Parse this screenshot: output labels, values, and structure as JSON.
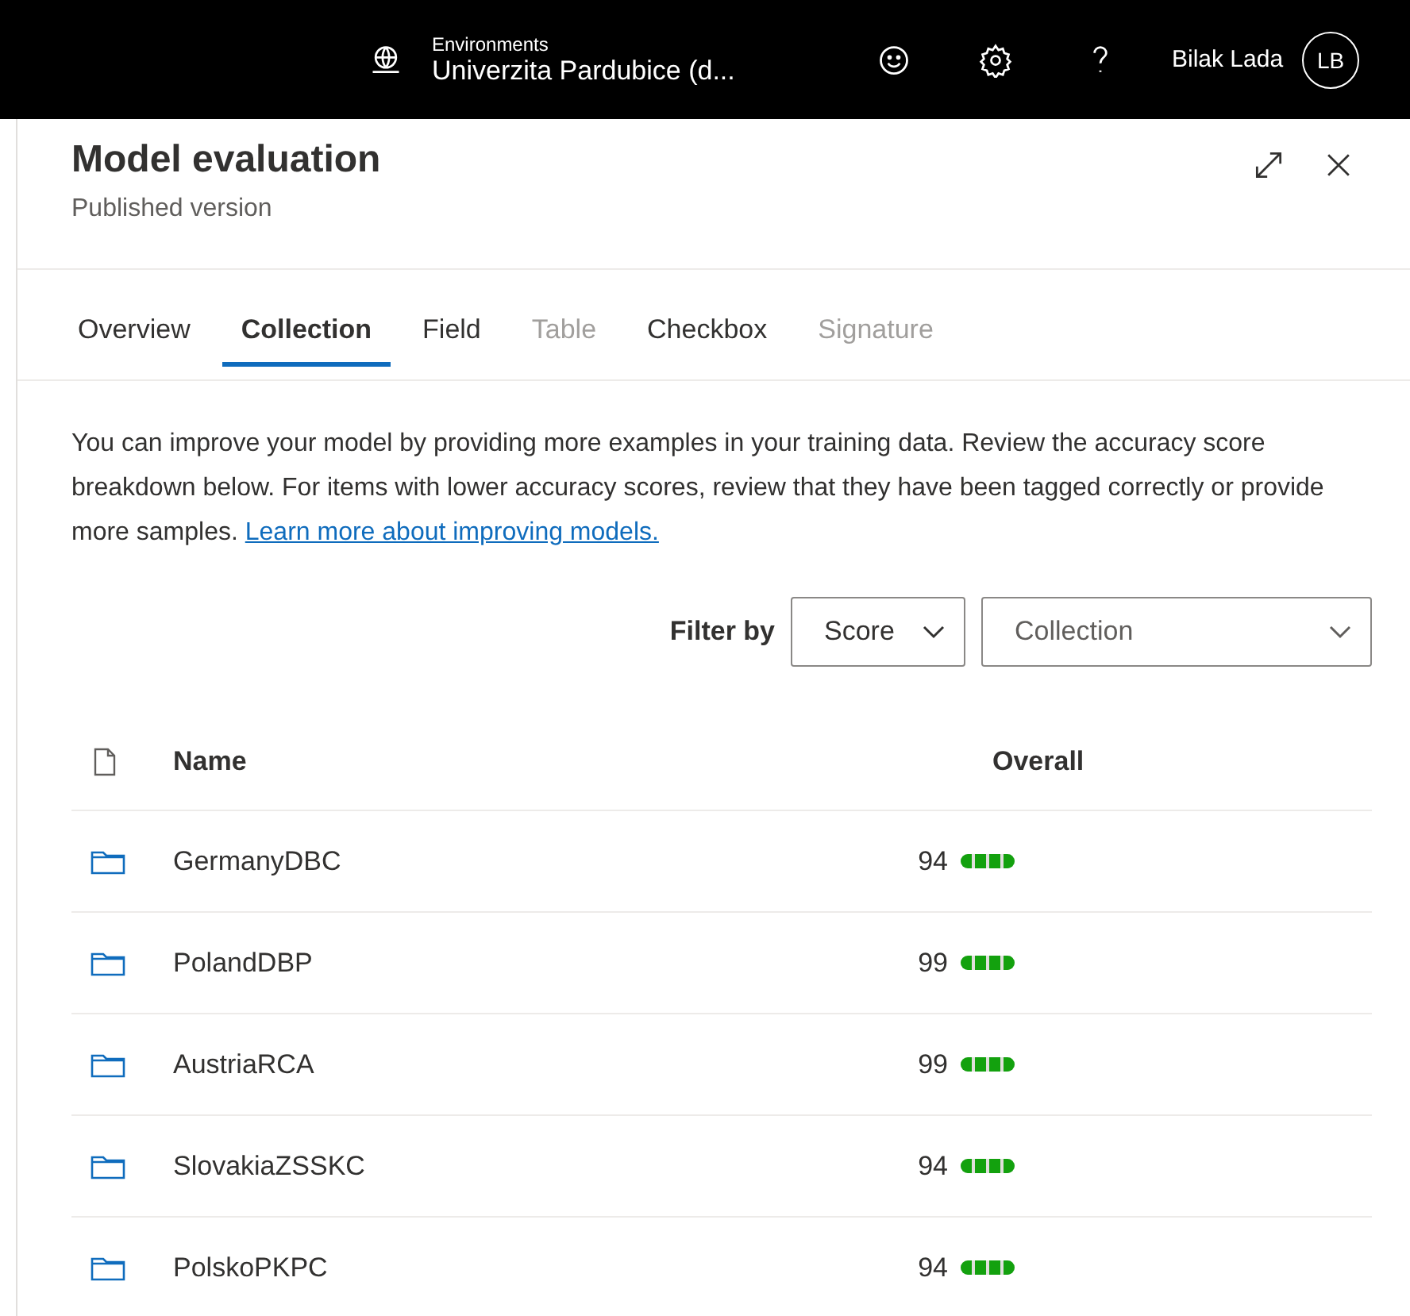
{
  "top_bar": {
    "environment_label": "Environments",
    "environment_name": "Univerzita Pardubice (d...",
    "user_name": "Bilak Lada",
    "avatar_initials": "LB"
  },
  "panel": {
    "title": "Model evaluation",
    "subtitle": "Published version"
  },
  "tabs": [
    {
      "label": "Overview",
      "selected": false,
      "disabled": false
    },
    {
      "label": "Collection",
      "selected": true,
      "disabled": false
    },
    {
      "label": "Field",
      "selected": false,
      "disabled": false
    },
    {
      "label": "Table",
      "selected": false,
      "disabled": true
    },
    {
      "label": "Checkbox",
      "selected": false,
      "disabled": false
    },
    {
      "label": "Signature",
      "selected": false,
      "disabled": true
    }
  ],
  "description": {
    "text": "You can improve your model by providing more examples in your training data. Review the accuracy score breakdown below. For items with lower accuracy scores, review that they have been tagged correctly or provide more samples.",
    "link": "Learn more about improving models."
  },
  "filter": {
    "label": "Filter by",
    "score_dropdown": "Score",
    "collection_dropdown": "Collection"
  },
  "table": {
    "columns": [
      "Name",
      "Overall"
    ],
    "rows": [
      {
        "name": "GermanyDBC",
        "score": "94",
        "level": 1
      },
      {
        "name": "PolandDBP",
        "score": "99",
        "level": 1
      },
      {
        "name": "AustriaRCA",
        "score": "99",
        "level": 1
      },
      {
        "name": "SlovakiaZSSKC",
        "score": "94",
        "level": 1
      },
      {
        "name": "PolskoPKPC",
        "score": "94",
        "level": 1
      }
    ]
  }
}
